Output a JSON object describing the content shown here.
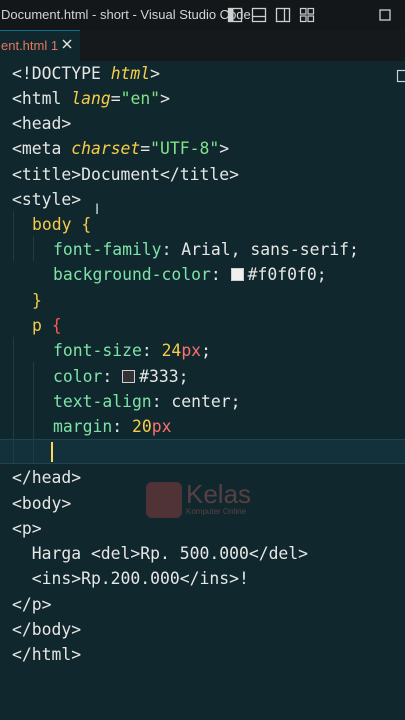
{
  "window": {
    "title": "Document.html - short - Visual Studio Code"
  },
  "tabs": [
    {
      "label": "ent.html 1"
    }
  ],
  "code": {
    "l1": {
      "open": "<!DOCTYPE ",
      "attr": "html",
      "close": ">"
    },
    "l2": {
      "open": "<html ",
      "attr": "lang",
      "eq": "=",
      "val": "\"en\"",
      "close": ">"
    },
    "l3": "<head>",
    "l4": {
      "open": "<meta ",
      "attr": "charset",
      "eq": "=",
      "val": "\"UTF-8\"",
      "close": ">"
    },
    "l5": {
      "open": "<title>",
      "text": "Document",
      "close": "</title>"
    },
    "l6": "<style>",
    "l7": {
      "selector": "body",
      "brace": "{"
    },
    "l8": {
      "prop": "font-family",
      "rest": ": Arial, sans-serif;"
    },
    "l9": {
      "prop": "background-color",
      "colon": ": ",
      "val": "#f0f0f0;"
    },
    "l10": "}",
    "l11": {
      "selector": "p",
      "brace": "{"
    },
    "l12": {
      "prop": "font-size",
      "colon": ": ",
      "num": "24",
      "unit": "px",
      "end": ";"
    },
    "l13": {
      "prop": "color",
      "colon": ": ",
      "val": "#333;"
    },
    "l14": {
      "prop": "text-align",
      "rest": ": center;"
    },
    "l15": {
      "prop": "margin",
      "colon": ": ",
      "num": "20",
      "unit": "px"
    },
    "l17": "</head>",
    "l18": "<body>",
    "l19": "<p>",
    "l20": "  Harga <del>Rp. 500.000</del>",
    "l21": "  <ins>Rp.200.000</ins>!",
    "l22": "</p>",
    "l23": "</body>",
    "l24": "</html>"
  },
  "colors": {
    "swatch_bg": "#f0f0f0",
    "swatch_text": "#333333"
  },
  "watermark": {
    "name": "Kelas",
    "sub": "Komputer Online"
  },
  "icons": [
    "layout-sidebar-left-icon",
    "layout-panel-icon",
    "layout-sidebar-right-icon",
    "customize-layout-icon",
    "maximize-icon",
    "close-tab-icon",
    "split-editor-icon"
  ]
}
